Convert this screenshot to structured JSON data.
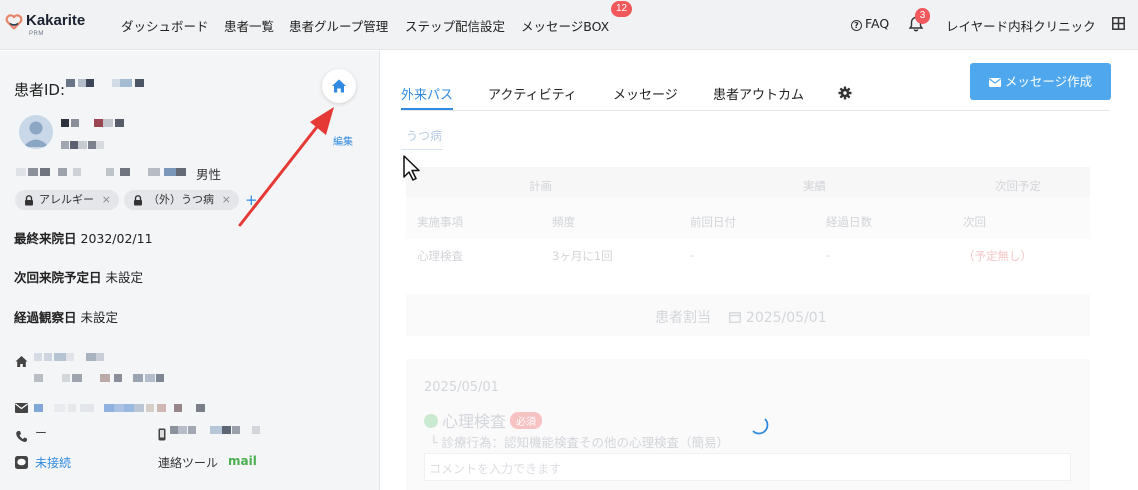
{
  "nav": {
    "logo_text": "Kakarite",
    "logo_sub": "PRM",
    "items": [
      {
        "label": "ダッシュボード"
      },
      {
        "label": "患者一覧"
      },
      {
        "label": "患者グループ管理"
      },
      {
        "label": "ステップ配信設定"
      },
      {
        "label": "メッセージBOX",
        "badge": "12"
      }
    ],
    "faq_label": "FAQ",
    "notification_badge": "3",
    "clinic_name": "レイヤード内科クリニック",
    "icons": [
      "heart-logo-icon",
      "question-circle-icon",
      "bell-icon",
      "grid-icon"
    ]
  },
  "patient": {
    "id_label": "患者ID:",
    "edit_label": "編集",
    "gender": "男性",
    "tags": [
      {
        "label": "アレルギー"
      },
      {
        "label": "（外）うつ病"
      }
    ],
    "tag_remove": "×",
    "add_tag": "+",
    "last_visit_label": "最終来院日",
    "last_visit_value": "2032/02/11",
    "next_visit_label": "次回来院予定日",
    "next_visit_value": "未設定",
    "observation_label": "経過観察日",
    "observation_value": "未設定",
    "phone_value": "ー",
    "line_status": "未接続",
    "contact_tool_label": "連絡ツール",
    "contact_tool_value": "mail",
    "icons": [
      "home-icon",
      "avatar-icon",
      "lock-icon",
      "house-icon",
      "mail-icon",
      "phone-icon",
      "mobile-icon",
      "line-icon"
    ]
  },
  "main": {
    "tabs": [
      {
        "label": "外来パス",
        "active": true
      },
      {
        "label": "アクティビティ"
      },
      {
        "label": "メッセージ"
      },
      {
        "label": "患者アウトカム"
      }
    ],
    "message_button": "メッセージ作成",
    "sub_tab": "うつ病",
    "table": {
      "group_headers": [
        "計画",
        "実績",
        "次回予定"
      ],
      "columns": [
        "実施事項",
        "頻度",
        "前回日付",
        "経過日数",
        "次回"
      ],
      "rows": [
        [
          "心理検査",
          "3ヶ月に1回",
          "-",
          "-",
          "（予定無し）"
        ]
      ]
    },
    "section_title": "患者割当",
    "section_date": "2025/05/01",
    "card": {
      "date": "2025/05/01",
      "item": "心理検査",
      "badge": "必須",
      "sub": "└ 診療行為：認知機能検査その他の心理検査（簡易）",
      "comment_placeholder": "コメントを入力できます"
    }
  },
  "colors": {
    "accent": "#2f8ae0",
    "button": "#4fa8ee",
    "badge": "#f1585c",
    "arrow": "#e53935",
    "mail_green": "#4caf50"
  }
}
